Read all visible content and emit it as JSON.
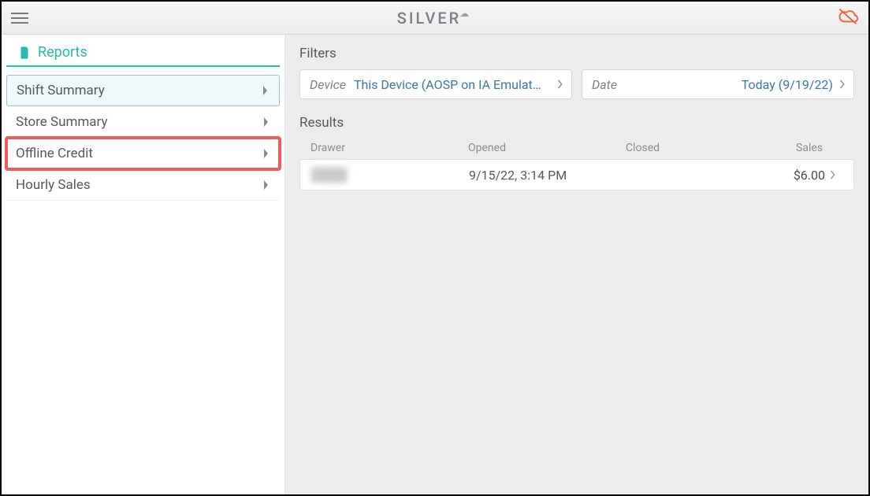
{
  "brand": {
    "text": "SILVER"
  },
  "sidebar": {
    "title": "Reports",
    "items": [
      {
        "label": "Shift Summary",
        "state": "selected"
      },
      {
        "label": "Store Summary",
        "state": ""
      },
      {
        "label": "Offline Credit",
        "state": "highlighted"
      },
      {
        "label": "Hourly Sales",
        "state": ""
      }
    ]
  },
  "filters": {
    "title": "Filters",
    "device": {
      "label": "Device",
      "value": "This Device (AOSP on IA Emulat…"
    },
    "date": {
      "label": "Date",
      "value": "Today (9/19/22)"
    }
  },
  "results": {
    "title": "Results",
    "columns": {
      "drawer": "Drawer",
      "opened": "Opened",
      "closed": "Closed",
      "sales": "Sales"
    },
    "rows": [
      {
        "drawer": "████",
        "opened": "9/15/22, 3:14 PM",
        "closed": "",
        "sales": "$6.00"
      }
    ]
  }
}
